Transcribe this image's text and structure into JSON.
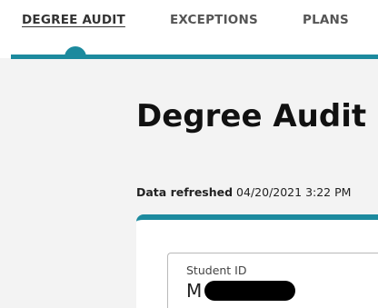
{
  "nav": {
    "tabs": [
      {
        "label": "DEGREE AUDIT",
        "active": true
      },
      {
        "label": "EXCEPTIONS",
        "active": false
      },
      {
        "label": "PLANS",
        "active": false
      }
    ]
  },
  "page": {
    "title": "Degree Audit",
    "refreshed_label": "Data refreshed",
    "refreshed_value": "04/20/2021 3:22 PM"
  },
  "student_field": {
    "label": "Student ID",
    "value": "M"
  },
  "colors": {
    "accent": "#1c8a9e",
    "background": "#f3f3f3",
    "card": "#ffffff"
  }
}
